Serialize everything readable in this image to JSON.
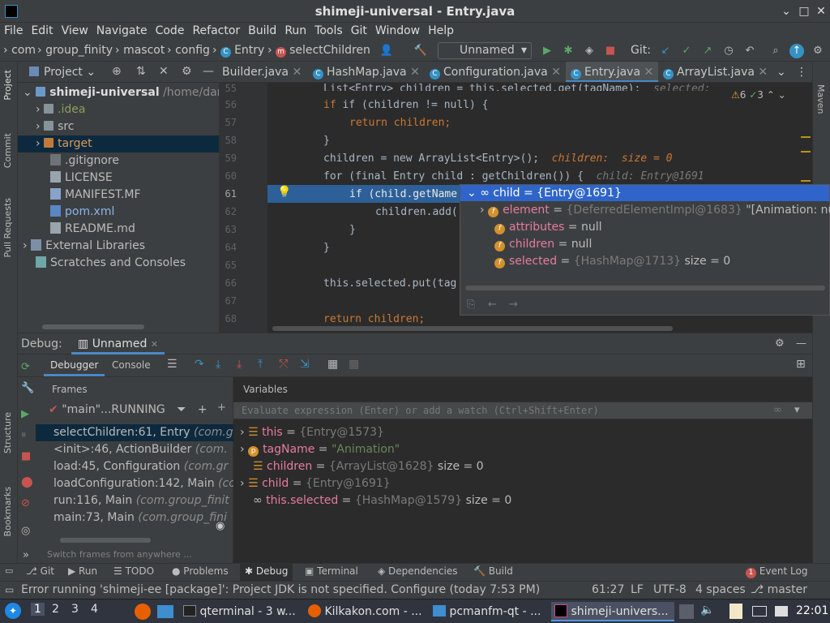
{
  "window": {
    "title": "shimeji-universal - Entry.java"
  },
  "menu": [
    "File",
    "Edit",
    "View",
    "Navigate",
    "Code",
    "Refactor",
    "Build",
    "Run",
    "Tools",
    "Git",
    "Window",
    "Help"
  ],
  "breadcrumbs": [
    "com",
    "group_finity",
    "mascot",
    "config",
    "Entry",
    "selectChildren"
  ],
  "run_config": "Unnamed",
  "git_label": "Git:",
  "project_panel": {
    "title": "Project",
    "root": "shimeji-universal",
    "root_path": "/home/dartz",
    "items": [
      ".idea",
      "src",
      "target",
      ".gitignore",
      "LICENSE",
      "MANIFEST.MF",
      "pom.xml",
      "README.md"
    ],
    "external": "External Libraries",
    "scratches": "Scratches and Consoles"
  },
  "editor_tabs": [
    "Builder.java",
    "HashMap.java",
    "Configuration.java",
    "Entry.java",
    "ArrayList.java"
  ],
  "inspections": {
    "warnings": "6",
    "ok": "3"
  },
  "code": {
    "lines": [
      "55",
      "56",
      "57",
      "58",
      "59",
      "60",
      "61",
      "62",
      "63",
      "64",
      "65",
      "66",
      "67",
      "68"
    ],
    "l55": "List<Entry> children = this.selected.get(tagName);",
    "l55_hint": "selected:",
    "l56": "if (children != null) {",
    "l57": "return children;",
    "l58": "}",
    "l59": "children = new ArrayList<Entry>();",
    "l59_hint": "children:  size = 0",
    "l60": "for (final Entry child : getChildren()) {",
    "l60_hint": "child: Entry@1691",
    "l61": "if (child.getName",
    "l62": "children.add(",
    "l63": "}",
    "l64": "}",
    "l66": "this.selected.put(tag",
    "l68": "return children;"
  },
  "popup": {
    "header": "child = {Entry@1691}",
    "rows": [
      {
        "name": "element",
        "value": "{DeferredElementImpl@1683}",
        "extra": "\"[Animation: null]\""
      },
      {
        "name": "attributes",
        "value": "null",
        "extra": ""
      },
      {
        "name": "children",
        "value": "null",
        "extra": ""
      },
      {
        "name": "selected",
        "value": "{HashMap@1713}",
        "extra": "size = 0"
      }
    ]
  },
  "debug": {
    "label": "Debug:",
    "config": "Unnamed",
    "tabs": [
      "Debugger",
      "Console"
    ],
    "frames_label": "Frames",
    "variables_label": "Variables",
    "thread": "\"main\"...RUNNING",
    "frames": [
      {
        "m": "selectChildren:61, Entry",
        "c": "(com.g"
      },
      {
        "m": "<init>:46, ActionBuilder",
        "c": "(com."
      },
      {
        "m": "load:45, Configuration",
        "c": "(com.gr"
      },
      {
        "m": "loadConfiguration:142, Main",
        "c": "(co"
      },
      {
        "m": "run:116, Main",
        "c": "(com.group_finit"
      },
      {
        "m": "main:73, Main",
        "c": "(com.group_fini"
      }
    ],
    "switch_hint": "Switch frames from anywhere ...",
    "eval_placeholder": "Evaluate expression (Enter) or add a watch (Ctrl+Shift+Enter)",
    "vars": [
      {
        "name": "this",
        "value": "{Entry@1573}",
        "extra": ""
      },
      {
        "name": "tagName",
        "value": "\"Animation\"",
        "extra": ""
      },
      {
        "name": "children",
        "value": "{ArrayList@1628}",
        "extra": "size = 0"
      },
      {
        "name": "child",
        "value": "{Entry@1691}",
        "extra": ""
      },
      {
        "name": "this.selected",
        "value": "{HashMap@1579}",
        "extra": "size = 0"
      }
    ]
  },
  "tool_windows": [
    "Git",
    "Run",
    "TODO",
    "Problems",
    "Debug",
    "Terminal",
    "Dependencies",
    "Build"
  ],
  "event_log": {
    "label": "Event Log",
    "count": "1"
  },
  "status": {
    "message": "Error running 'shimeji-ee [package]': Project JDK is not specified. Configure (today 7:53 PM)",
    "position": "61:27",
    "line_sep": "LF",
    "encoding": "UTF-8",
    "indent": "4 spaces",
    "branch": "master"
  },
  "left_tabs": [
    "Project",
    "Commit",
    "Pull Requests",
    "Structure",
    "Bookmarks"
  ],
  "right_tabs": [
    "Maven"
  ],
  "taskbar": {
    "workspaces": [
      "1",
      "2",
      "3",
      "4"
    ],
    "tasks": [
      "qterminal - 3 w...",
      "Kilkakon.com - ...",
      "pcmanfm-qt - ...",
      "shimeji-univers..."
    ],
    "clock": "22:01"
  }
}
